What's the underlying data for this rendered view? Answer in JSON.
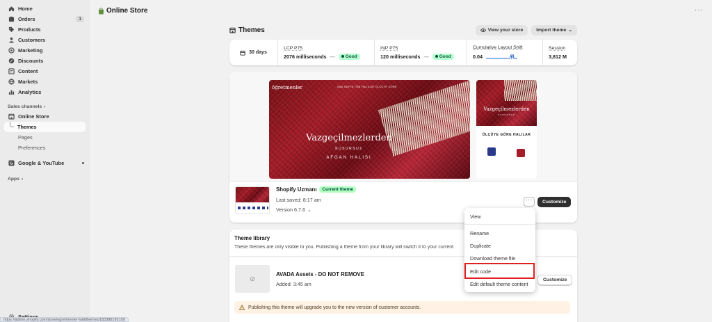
{
  "sidebar": {
    "items": [
      {
        "label": "Home",
        "icon": "home-icon"
      },
      {
        "label": "Orders",
        "icon": "orders-icon",
        "badge": "1"
      },
      {
        "label": "Products",
        "icon": "tag-icon"
      },
      {
        "label": "Customers",
        "icon": "person-icon"
      },
      {
        "label": "Marketing",
        "icon": "target-icon"
      },
      {
        "label": "Discounts",
        "icon": "discount-icon"
      },
      {
        "label": "Content",
        "icon": "content-icon"
      },
      {
        "label": "Markets",
        "icon": "globe-icon"
      },
      {
        "label": "Analytics",
        "icon": "chart-icon"
      }
    ],
    "sales_channels_label": "Sales channels",
    "online_store": "Online Store",
    "themes": "Themes",
    "pages": "Pages",
    "preferences": "Preferences",
    "google_youtube": "Google & YouTube",
    "apps_label": "Apps",
    "settings": "Settings",
    "status_url": "https://admin.shopify.com/store/ogretmenler-hali/themes/183386192109"
  },
  "topbar": {
    "title": "Online Store",
    "more": "···"
  },
  "header": {
    "title": "Themes",
    "view_store": "View your store",
    "import_theme": "Import theme"
  },
  "metrics": {
    "range": "30 days",
    "lcp_label": "LCP P75",
    "lcp_value": "2076 milliseconds",
    "inp_label": "INP P75",
    "inp_value": "120 milliseconds",
    "good": "Good",
    "dash": "—",
    "cls_label": "Cumulative Layout Shift",
    "cls_value": "0.04",
    "sessions_label": "Session",
    "sessions_value": "3,812 M"
  },
  "preview": {
    "brand": "öğretmenler",
    "nav": "ANA SAYFA   TÜM HALILAR   ÖLÇÜYE GÖRE",
    "hero_title": "Vazgeçilmezlerden",
    "hero_sub1": "KUSURSUZ",
    "hero_sub2": "AFGAN HALISI",
    "mobile_title": "Vazgeçilmezlerden",
    "mobile_sub": "KUSURSUZ",
    "mobile_heading": "ÖLÇÜYE GÖRE HALILAR"
  },
  "current_theme": {
    "name": "Shopify Uzmanı",
    "badge": "Current theme",
    "saved": "Last saved: 8:17 am",
    "version": "Version 6.7.6",
    "customize": "Customize",
    "more": "···"
  },
  "library": {
    "title": "Theme library",
    "desc": "These themes are only visible to you. Publishing a theme from your library will switch it to your current",
    "theme_name": "AVADA Assets - DO NOT REMOVE",
    "added": "Added: 3:45 am",
    "customize": "Customize",
    "warning": "Publishing this theme will upgrade you to the new version of customer accounts."
  },
  "menu": {
    "items": [
      "View",
      "Rename",
      "Duplicate",
      "Download theme file",
      "Edit code",
      "Edit default theme content"
    ],
    "highlight_color": "#e02020"
  }
}
